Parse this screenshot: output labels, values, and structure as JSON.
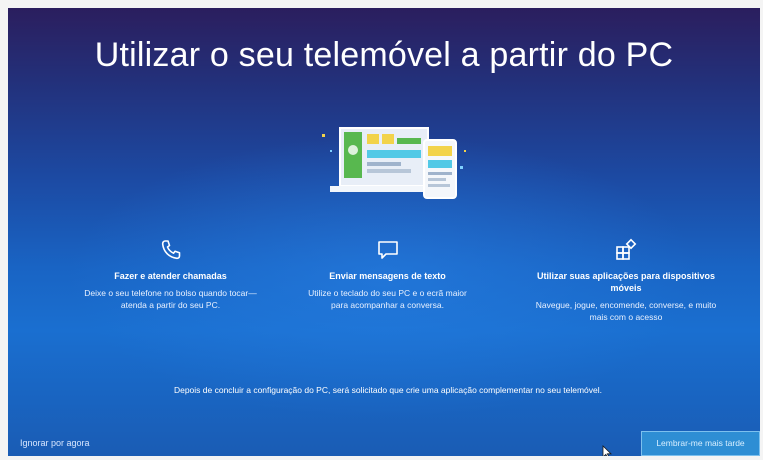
{
  "page": {
    "title": "Utilizar o seu telemóvel a partir do PC"
  },
  "features": [
    {
      "icon": "phone-icon",
      "title": "Fazer e atender chamadas",
      "description": "Deixe o seu telefone no bolso quando tocar—atenda a partir do seu PC."
    },
    {
      "icon": "message-icon",
      "title": "Enviar mensagens de texto",
      "description": "Utilize o teclado do seu PC e o ecrã maior para acompanhar a conversa."
    },
    {
      "icon": "apps-icon",
      "title": "Utilizar suas aplicações para dispositivos móveis",
      "description": "Navegue, jogue, encomende, converse, e muito mais com o acesso"
    }
  ],
  "footer_note": "Depois de concluir a configuração do PC, será solicitado que crie uma aplicação complementar no seu telemóvel.",
  "actions": {
    "skip_label": "Ignorar por agora",
    "remind_label": "Lembrar-me mais tarde"
  },
  "colors": {
    "accent_button": "#2e8ed4",
    "hero_yellow": "#f2d34a",
    "hero_green": "#58b84f",
    "hero_cyan": "#52c9e6"
  }
}
